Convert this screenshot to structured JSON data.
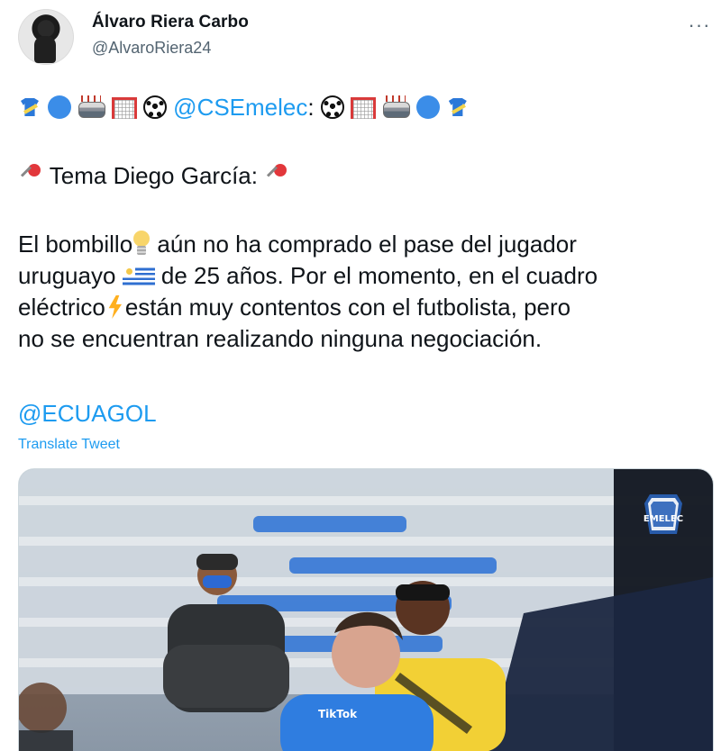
{
  "author": {
    "name": "Álvaro Riera Carbo",
    "handle": "@AlvaroRiera24"
  },
  "tweet": {
    "line1_mention": "@CSEmelec",
    "line1_after": ":",
    "line2_text": "Tema Diego García:",
    "paragraph": {
      "line1_a": "El bombillo",
      "line1_b": "aún no ha comprado el pase del jugador",
      "line2_a": "uruguayo",
      "line2_b": "de 25 años. Por el momento, en el cuadro",
      "line3_a": "eléctrico",
      "line3_b": "están muy contentos con el futbolista, pero",
      "line4": "no se encuentran realizando ninguna negociación."
    },
    "mention2": "@ECUAGOL",
    "translate": "Translate Tweet"
  },
  "icons": {
    "more": "more-horizontal-icon",
    "emojis": [
      "shirt-icon",
      "blue-circle-icon",
      "stadium-icon",
      "goal-net-icon",
      "soccer-ball-icon",
      "pin-icon",
      "bulb-icon",
      "uruguay-flag-icon",
      "lightning-icon"
    ]
  },
  "media": {
    "badge_text": "EMELEC",
    "jersey_text": "TikTok"
  },
  "colors": {
    "accent": "#1d9bf0",
    "secondary_text": "#536471",
    "primary_text": "#0f1419"
  }
}
